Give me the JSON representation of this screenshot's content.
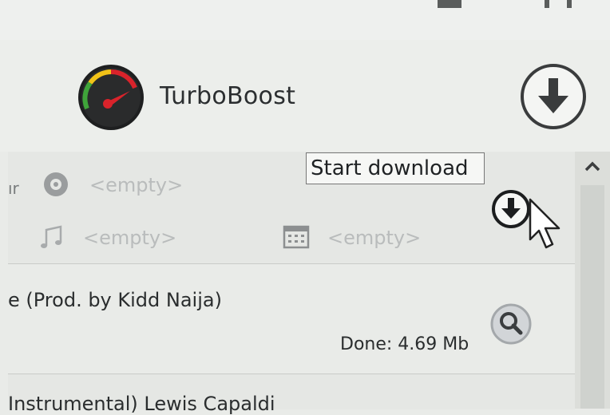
{
  "app": {
    "name": "TurboBoost"
  },
  "tooltip": {
    "text": "Start download"
  },
  "rows": [
    {
      "title_fragment": "ır",
      "album": "<empty>",
      "artist": "<empty>",
      "date": "<empty>"
    },
    {
      "title_fragment": "e (Prod. by Kidd Naija)",
      "status": "Done: 4.69 Mb"
    },
    {
      "title_fragment": "Instrumental) Lewis Capaldi"
    }
  ],
  "icons": {
    "logo": "speedometer-logo-icon",
    "header_download": "download-circle-icon",
    "row_download": "download-circle-icon",
    "search": "magnifier-icon",
    "album": "disc-icon",
    "artist": "music-note-icon",
    "date": "calendar-icon",
    "cursor": "mouse-pointer-icon",
    "scroll_up": "chevron-up-icon"
  },
  "colors": {
    "background": "#e9ebe8",
    "accent_red": "#d9232b",
    "accent_green": "#3fa43a",
    "accent_yellow": "#f2c318"
  }
}
